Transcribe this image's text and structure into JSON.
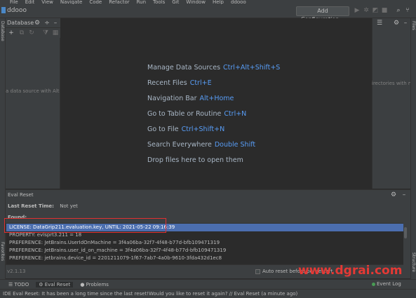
{
  "menu": [
    "File",
    "Edit",
    "View",
    "Navigate",
    "Code",
    "Refactor",
    "Run",
    "Tools",
    "Git",
    "Window",
    "Help",
    "ddooo"
  ],
  "project": {
    "name": "ddooo"
  },
  "toolbar": {
    "add_config": "Add Configuration..."
  },
  "sidebar": {
    "left_tab": "Database",
    "right_tab": "Files"
  },
  "db_panel": {
    "title": "Database",
    "hint": "a data source with Alt"
  },
  "right_panel": {
    "hint": "irectories with m"
  },
  "welcome": {
    "items": [
      {
        "label": "Manage Data Sources",
        "shortcut": "Ctrl+Alt+Shift+S"
      },
      {
        "label": "Recent Files",
        "shortcut": "Ctrl+E"
      },
      {
        "label": "Navigation Bar",
        "shortcut": "Alt+Home"
      },
      {
        "label": "Go to Table or Routine",
        "shortcut": "Ctrl+N"
      },
      {
        "label": "Go to File",
        "shortcut": "Ctrl+Shift+N"
      },
      {
        "label": "Search Everywhere",
        "shortcut": "Double Shift"
      },
      {
        "label": "Drop files here to open them",
        "shortcut": ""
      }
    ]
  },
  "eval": {
    "title": "Eval Reset",
    "last_reset_label": "Last Reset Time:",
    "last_reset_value": "Not yet",
    "found_label": "Found:",
    "found_items": [
      "LICENSE: DataGrip211.evaluation.key, UNTIL: 2021-05-22 09:16:39",
      "PROPERTY: evlsprt3.211 = 18",
      "PREFERENCE: JetBrains.UserIdOnMachine = 3f4a06ba-32f7-4f48-b77d-bfb109471319",
      "PREFERENCE: JetBrains.user_id_on_machine = 3f4a06ba-32f7-4f48-b77d-bfb109471319",
      "PREFERENCE: jetbrains.device_id = 2201211079-1f67-7ab7-4a0b-9610-3fda432d1ec8"
    ],
    "version": "v2.1.13",
    "auto_reset": "Auto reset before per restart"
  },
  "watermark": "www.dgrai.com",
  "side_labels": {
    "favorites": "Favorites",
    "structure": "Structure"
  },
  "bottom_tabs": [
    "TODO",
    "Eval Reset",
    "Problems"
  ],
  "event_log": "Event Log",
  "status": "IDE Eval Reset: It has been a long time since the last reset!Would you like to reset it again? // Eval Reset (a minute ago)"
}
